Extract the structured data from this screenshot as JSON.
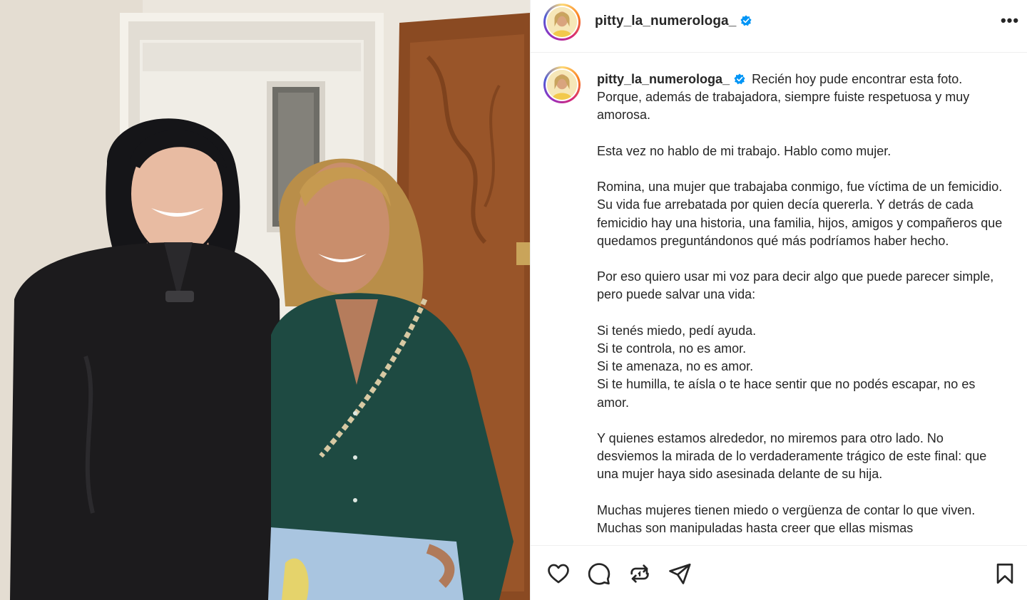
{
  "post": {
    "username": "pitty_la_numerologa_",
    "verified": true,
    "more_label": "•••",
    "caption_lines": [
      "Recién hoy pude encontrar esta foto. Porque, además de trabajadora, siempre fuiste respetuosa y muy amorosa.",
      "Esta vez no hablo de mi trabajo. Hablo como mujer.",
      "Romina, una mujer que trabajaba conmigo, fue víctima de un femicidio. Su vida fue arrebatada por quien decía quererla. Y detrás de cada femicidio hay una historia, una familia, hijos, amigos y compañeros que quedamos preguntándonos qué más podríamos haber hecho.",
      "Por eso quiero usar mi voz para decir algo que puede parecer simple, pero puede salvar una vida:",
      "Si tenés miedo, pedí ayuda.",
      "Si te controla, no es amor.",
      "Si te amenaza, no es amor.",
      "Si te humilla, te aísla o te hace sentir que no podés escapar, no es amor.",
      "Y quienes estamos alrededor, no miremos para otro lado. No desviemos la mirada de lo verdaderamente trágico de este final: que una mujer haya sido asesinada delante de su hija.",
      "Muchas mujeres tienen miedo o vergüenza de contar lo que viven. Muchas son manipuladas hasta creer que ellas mismas"
    ]
  },
  "actions": {
    "like": "heart-icon",
    "comment": "comment-icon",
    "repost": "repost-icon",
    "share": "share-icon",
    "save": "bookmark-icon"
  },
  "colors": {
    "text": "#262626",
    "verified": "#0095f6",
    "divider": "#efefef"
  }
}
